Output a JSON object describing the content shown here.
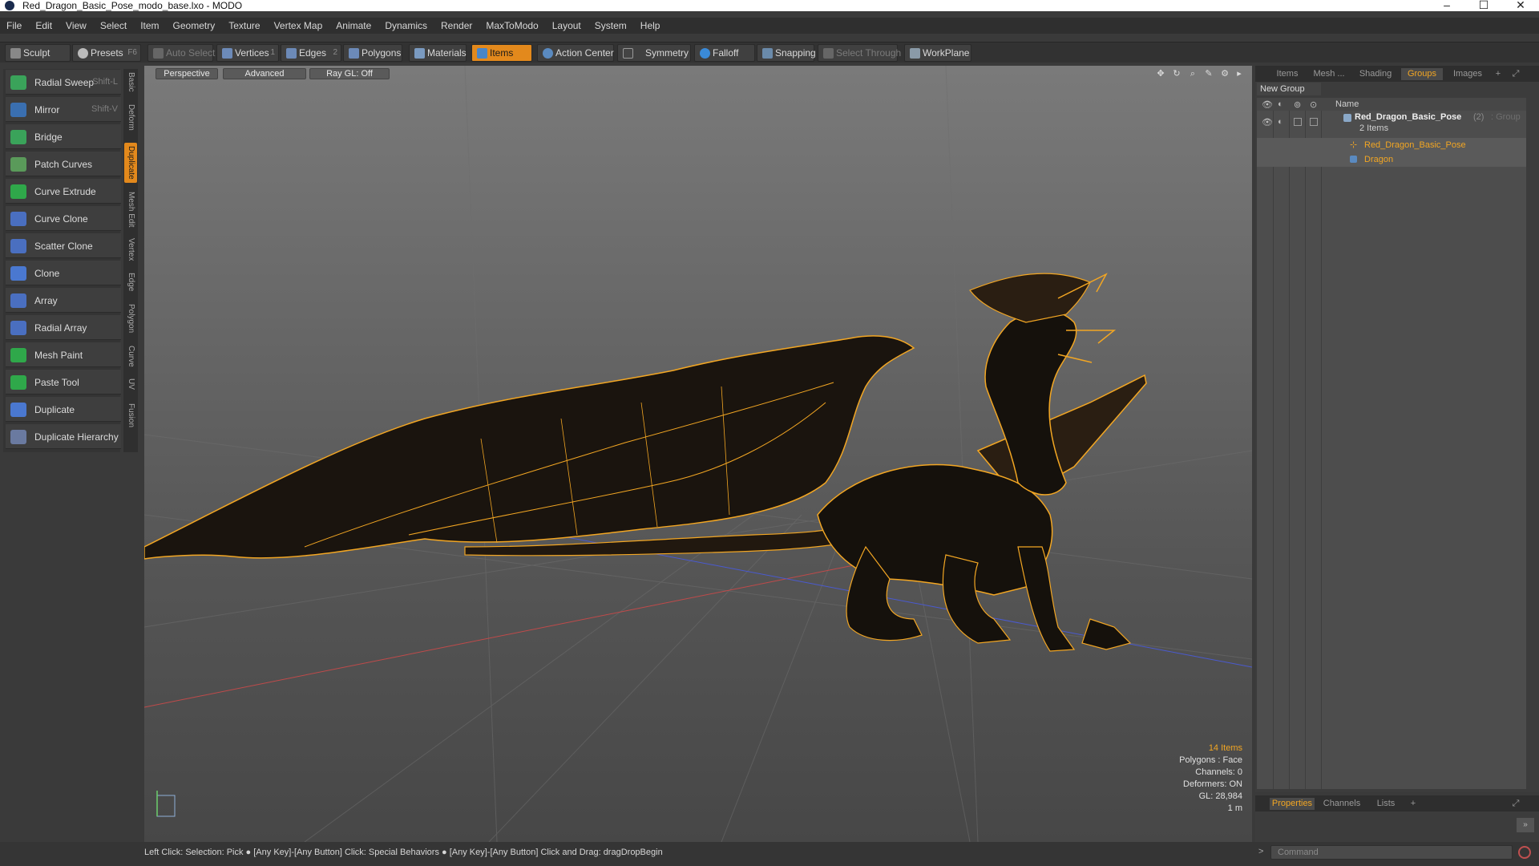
{
  "window": {
    "title": "Red_Dragon_Basic_Pose_modo_base.lxo - MODO",
    "controls": [
      "–",
      "☐",
      "✕"
    ]
  },
  "menu": [
    "File",
    "Edit",
    "View",
    "Select",
    "Item",
    "Geometry",
    "Texture",
    "Vertex Map",
    "Animate",
    "Dynamics",
    "Render",
    "MaxToModo",
    "Layout",
    "System",
    "Help"
  ],
  "toolbar": {
    "sculpt": "Sculpt",
    "presets": "Presets",
    "presets_shortcut": "F6",
    "auto_select": "Auto Select",
    "vertices": "Vertices",
    "vertices_count": "1",
    "edges": "Edges",
    "edges_count": "2",
    "polygons": "Polygons",
    "materials": "Materials",
    "items": "Items",
    "action_center": "Action Center",
    "symmetry": "Symmetry",
    "falloff": "Falloff",
    "snapping": "Snapping",
    "select_through": "Select Through",
    "workplane": "WorkPlane"
  },
  "tools": [
    {
      "label": "Radial Sweep",
      "shortcut": "Shift-L",
      "color": "#3aa35a"
    },
    {
      "label": "Mirror",
      "shortcut": "Shift-V",
      "color": "#3a6fb0"
    },
    {
      "label": "Bridge",
      "shortcut": "",
      "color": "#3aa35a"
    },
    {
      "label": "Patch Curves",
      "shortcut": "",
      "color": "#5a9a5a"
    },
    {
      "label": "Curve Extrude",
      "shortcut": "",
      "color": "#2fa84a"
    },
    {
      "label": "Curve Clone",
      "shortcut": "",
      "color": "#4a6fc0"
    },
    {
      "label": "Scatter Clone",
      "shortcut": "",
      "color": "#4a6fc0"
    },
    {
      "label": "Clone",
      "shortcut": "",
      "color": "#4a78d0"
    },
    {
      "label": "Array",
      "shortcut": "",
      "color": "#4a6fc0"
    },
    {
      "label": "Radial Array",
      "shortcut": "",
      "color": "#4a6fc0"
    },
    {
      "label": "Mesh Paint",
      "shortcut": "",
      "color": "#2fa84a"
    },
    {
      "label": "Paste Tool",
      "shortcut": "",
      "color": "#2fa84a"
    },
    {
      "label": "Duplicate",
      "shortcut": "",
      "color": "#4a78d0"
    },
    {
      "label": "Duplicate Hierarchy",
      "shortcut": "",
      "color": "#6a7aa0"
    }
  ],
  "vertical_tabs": [
    "Basic",
    "Deform",
    "Duplicate",
    "Mesh Edit",
    "Vertex",
    "Edge",
    "Polygon",
    "Curve",
    "UV",
    "Fusion"
  ],
  "viewport": {
    "view_mode": "Perspective",
    "shading": "Advanced",
    "raygl": "Ray GL: Off",
    "stats": {
      "items": "14 Items",
      "polygons": "Polygons : Face",
      "channels": "Channels: 0",
      "deformers": "Deformers: ON",
      "gl": "GL: 28,984",
      "unit": "1 m"
    }
  },
  "right_panel": {
    "tabs": [
      "Items",
      "Mesh ...",
      "Shading",
      "Groups",
      "Images"
    ],
    "active_tab": "Groups",
    "new_group": "New Group",
    "column_name": "Name",
    "group": {
      "name": "Red_Dragon_Basic_Pose",
      "count": "(2)",
      "type": ": Group",
      "items_label": "2 Items"
    },
    "children": [
      "Red_Dragon_Basic_Pose",
      "Dragon"
    ],
    "bottom_tabs": [
      "Properties",
      "Channels",
      "Lists"
    ],
    "command_placeholder": "Command"
  },
  "status": "Left Click: Selection: Pick ● [Any Key]-[Any Button] Click: Special Behaviors ● [Any Key]-[Any Button] Click and Drag: dragDropBegin",
  "colors": {
    "accent": "#e3891c",
    "wire": "#f2a623",
    "panel": "#3c3c3c"
  }
}
